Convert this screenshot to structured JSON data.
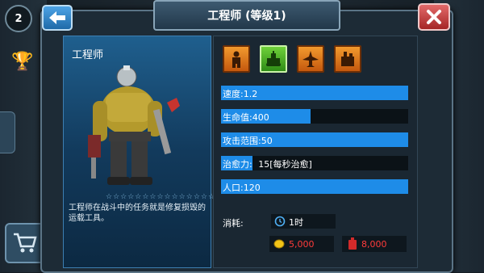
{
  "hud": {
    "round_number": "2"
  },
  "dialog": {
    "title": "工程师 (等级1)",
    "unit_name": "工程师",
    "description": "工程师在战斗中的任务就是修复损毁的运载工具。",
    "star_row": "☆☆☆☆☆☆☆☆☆☆☆☆☆☆☆",
    "icons": [
      {
        "name": "infantry-icon",
        "active": false
      },
      {
        "name": "tank-icon",
        "active": true
      },
      {
        "name": "aircraft-icon",
        "active": false
      },
      {
        "name": "building-icon",
        "active": false
      }
    ],
    "stats": [
      {
        "label": "速度:1.2",
        "fill": 1.0
      },
      {
        "label": "生命值:400",
        "fill": 0.48
      },
      {
        "label": "攻击范围:50",
        "fill": 1.0
      },
      {
        "label": "治愈力:",
        "value": "15[每秒治愈]",
        "fill": 0.17
      },
      {
        "label": "人口:120",
        "fill": 1.0
      }
    ],
    "consume_label": "消耗:",
    "time_cost": "1时",
    "gold_cost": "5,000",
    "fuel_cost": "8,000"
  },
  "colors": {
    "stat_bar": "#1e8ce8",
    "accent_orange": "#f29a2e",
    "close_red": "#c73030"
  }
}
